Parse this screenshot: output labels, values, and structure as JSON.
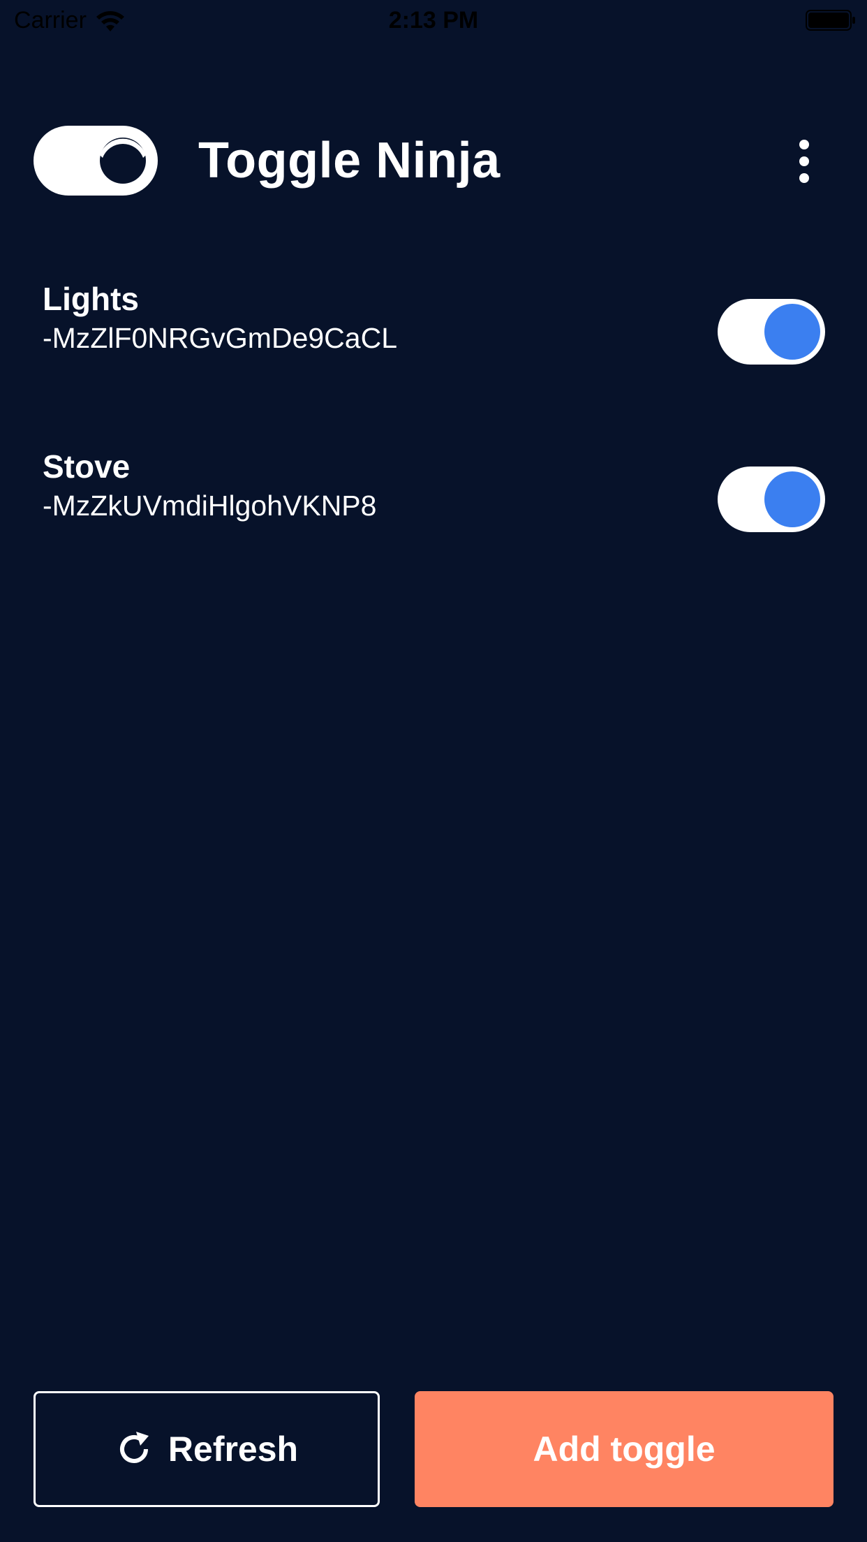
{
  "status_bar": {
    "carrier": "Carrier",
    "time": "2:13 PM",
    "wifi_icon": "wifi-icon",
    "battery_icon": "battery-icon"
  },
  "header": {
    "logo_icon": "toggle-logo-icon",
    "title": "Toggle Ninja",
    "menu_icon": "more-vertical-icon"
  },
  "toggles": [
    {
      "name": "Lights",
      "id": "-MzZlF0NRGvGmDe9CaCL",
      "enabled": true
    },
    {
      "name": "Stove",
      "id": "-MzZkUVmdiHlgohVKNP8",
      "enabled": true
    }
  ],
  "actions": {
    "refresh_label": "Refresh",
    "refresh_icon": "refresh-icon",
    "add_label": "Add toggle"
  },
  "colors": {
    "background": "#07122a",
    "switch_on_knob": "#3b7ff0",
    "accent": "#ff8462",
    "text": "#ffffff"
  }
}
